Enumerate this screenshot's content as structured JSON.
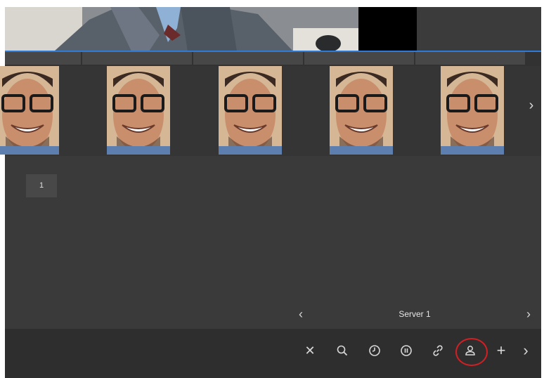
{
  "content": {
    "page_number": "1"
  },
  "server_nav": {
    "prev_icon": "chevron-left-icon",
    "label": "Server 1",
    "next_icon": "chevron-right-icon"
  },
  "strip": {
    "next_icon": "chevron-right-icon",
    "thumb_count": 5
  },
  "toolbar": {
    "items": [
      {
        "icon": "close-icon",
        "glyph": "✕"
      },
      {
        "icon": "search-icon"
      },
      {
        "icon": "clock-icon"
      },
      {
        "icon": "pause-icon"
      },
      {
        "icon": "link-icon"
      },
      {
        "icon": "person-icon",
        "active": true
      },
      {
        "icon": "plus-icon",
        "glyph": "+"
      },
      {
        "icon": "chevron-right-icon",
        "glyph": "›"
      }
    ]
  },
  "colors": {
    "background": "#353535",
    "toolbar": "#2e2e2e",
    "accent_border": "#2d7bd6",
    "highlight_ring": "#d21f24"
  }
}
